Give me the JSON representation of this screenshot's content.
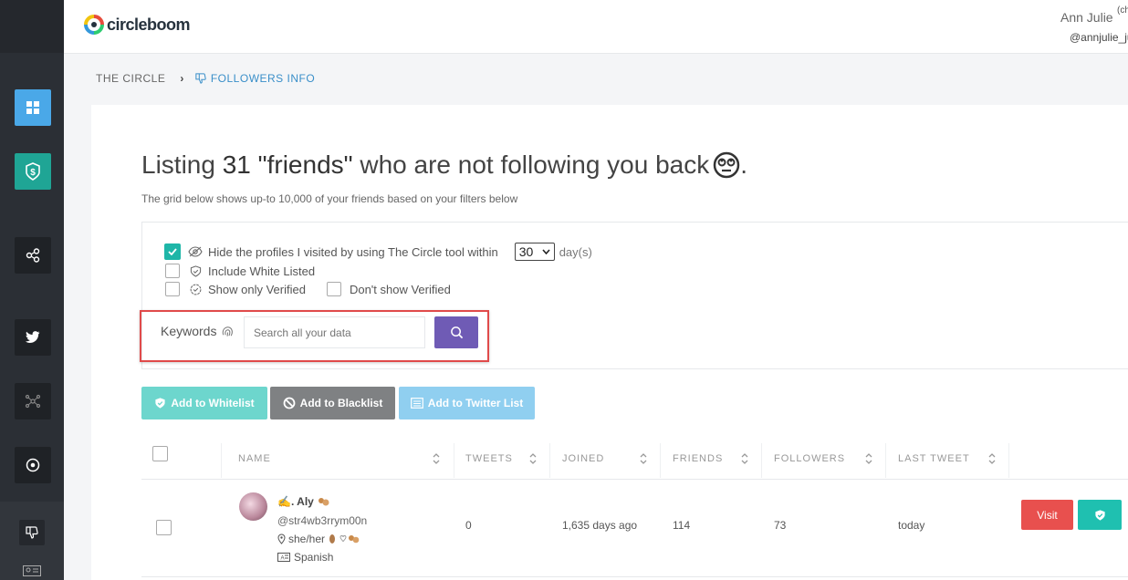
{
  "brand": {
    "name": "circleboom"
  },
  "user": {
    "name": "Ann Julie",
    "name_suffix": "(ch",
    "handle": "@annjulie_ju"
  },
  "breadcrumb": {
    "home": "THE CIRCLE",
    "current": "FOLLOWERS INFO"
  },
  "headline": {
    "prefix": "Listing",
    "count": "31",
    "term": "\"friends\"",
    "suffix": "who are not following you back",
    "end": "."
  },
  "subtitle": "The grid below shows up-to 10,000 of your friends based on your filters below",
  "filters": {
    "hide_visited": {
      "label": "Hide the profiles I visited by using The Circle tool within",
      "checked": true,
      "days_value": "30",
      "days_unit": "day(s)"
    },
    "include_whitelisted": {
      "label": "Include White Listed",
      "checked": false
    },
    "only_verified": {
      "label": "Show only Verified",
      "checked": false
    },
    "dont_show_verified": {
      "label": "Don't show Verified",
      "checked": false
    }
  },
  "search": {
    "label": "Keywords",
    "placeholder": "Search all your data"
  },
  "actions": {
    "whitelist": "Add to Whitelist",
    "blacklist": "Add to Blacklist",
    "twitter_list": "Add to Twitter List"
  },
  "table": {
    "columns": [
      "NAME",
      "TWEETS",
      "JOINED",
      "FRIENDS",
      "FOLLOWERS",
      "LAST TWEET"
    ],
    "rows": [
      {
        "name": "✍. Aly",
        "handle": "@str4wb3rrym00n",
        "bio": "she/her",
        "language": "Spanish",
        "tweets": "0",
        "joined": "1,635 days ago",
        "friends": "114",
        "followers": "73",
        "last_tweet": "today",
        "visit_label": "Visit"
      }
    ]
  },
  "colors": {
    "sidebar": "#2b2f35",
    "accent_teal": "#1fb6a8",
    "accent_purple": "#6f5bb5",
    "danger": "#e8504e",
    "link_blue": "#3a8fc9"
  }
}
